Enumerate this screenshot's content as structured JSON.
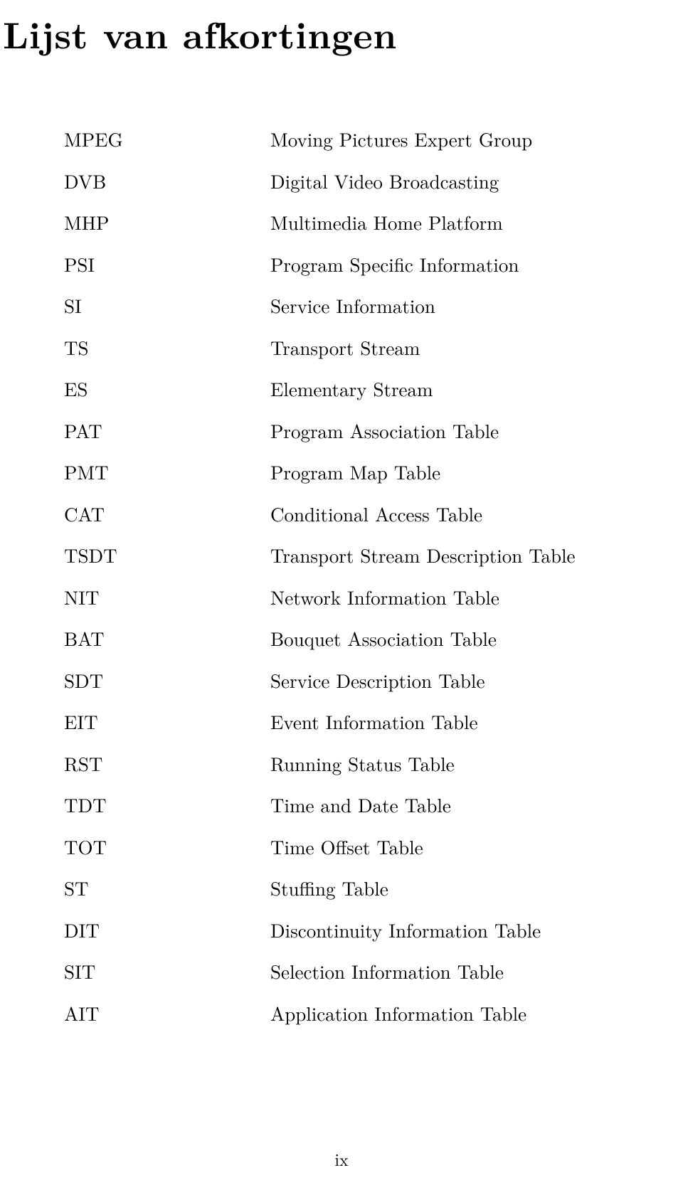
{
  "title": "Lijst van afkortingen",
  "entries": [
    {
      "abbr": "MPEG",
      "desc": "Moving Pictures Expert Group"
    },
    {
      "abbr": "DVB",
      "desc": "Digital Video Broadcasting"
    },
    {
      "abbr": "MHP",
      "desc": "Multimedia Home Platform"
    },
    {
      "abbr": "PSI",
      "desc": "Program Specific Information"
    },
    {
      "abbr": "SI",
      "desc": "Service Information"
    },
    {
      "abbr": "TS",
      "desc": "Transport Stream"
    },
    {
      "abbr": "ES",
      "desc": "Elementary Stream"
    },
    {
      "abbr": "PAT",
      "desc": "Program Association Table"
    },
    {
      "abbr": "PMT",
      "desc": "Program Map Table"
    },
    {
      "abbr": "CAT",
      "desc": "Conditional Access Table"
    },
    {
      "abbr": "TSDT",
      "desc": "Transport Stream Description Table"
    },
    {
      "abbr": "NIT",
      "desc": "Network Information Table"
    },
    {
      "abbr": "BAT",
      "desc": "Bouquet Association Table"
    },
    {
      "abbr": "SDT",
      "desc": "Service Description Table"
    },
    {
      "abbr": "EIT",
      "desc": "Event Information Table"
    },
    {
      "abbr": "RST",
      "desc": "Running Status Table"
    },
    {
      "abbr": "TDT",
      "desc": "Time and Date Table"
    },
    {
      "abbr": "TOT",
      "desc": "Time Offset Table"
    },
    {
      "abbr": "ST",
      "desc": "Stuffing Table"
    },
    {
      "abbr": "DIT",
      "desc": "Discontinuity Information Table"
    },
    {
      "abbr": "SIT",
      "desc": "Selection Information Table"
    },
    {
      "abbr": "AIT",
      "desc": "Application Information Table"
    }
  ],
  "page_number": "ix"
}
